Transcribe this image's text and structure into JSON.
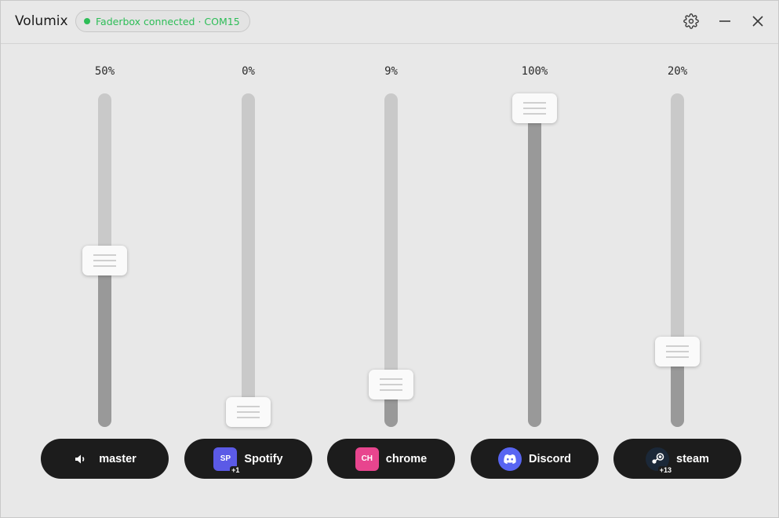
{
  "app": {
    "title": "Volumix",
    "status_text": "Faderbox connected · COM15",
    "status_color": "#2dbd57"
  },
  "colors": {
    "button_bg": "#1c1c1c",
    "track": "#c9c9c9",
    "track_fill": "#999999"
  },
  "channels": [
    {
      "label": "master",
      "volume": 50,
      "icon": "speaker-icon",
      "abbr": "",
      "icon_color": "",
      "badge": ""
    },
    {
      "label": "Spotify",
      "volume": 0,
      "icon": "app-icon",
      "abbr": "SP",
      "icon_color": "#5b5ae6",
      "badge": "+1"
    },
    {
      "label": "chrome",
      "volume": 9,
      "icon": "app-icon",
      "abbr": "CH",
      "icon_color": "#e8458e",
      "badge": ""
    },
    {
      "label": "Discord",
      "volume": 100,
      "icon": "discord-icon",
      "abbr": "",
      "icon_color": "#5865f2",
      "badge": ""
    },
    {
      "label": "steam",
      "volume": 20,
      "icon": "steam-icon",
      "abbr": "",
      "icon_color": "#1b2838",
      "badge": "+13"
    }
  ],
  "pct_text": [
    "50%",
    "0%",
    "9%",
    "100%",
    "20%"
  ]
}
